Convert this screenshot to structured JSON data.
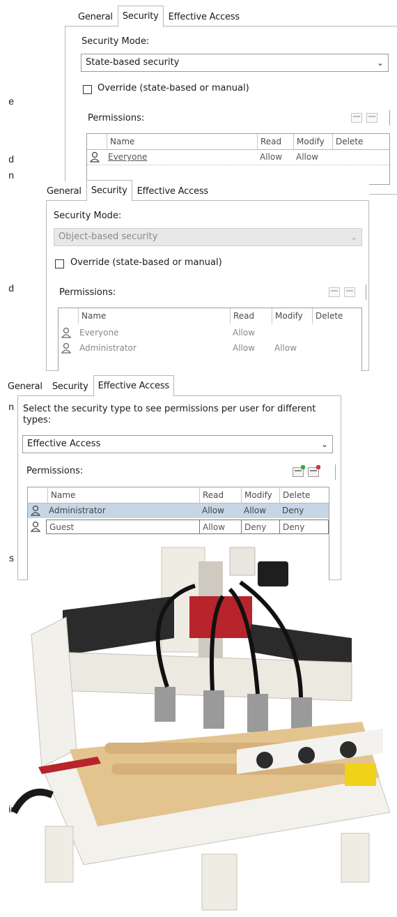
{
  "margin_fragments": [
    "e",
    "d",
    "n",
    "d",
    "n",
    "s",
    "ir"
  ],
  "panel1": {
    "tabs": [
      "General",
      "Security",
      "Effective Access"
    ],
    "active_tab": "Security",
    "security_mode_label": "Security Mode:",
    "security_mode_value": "State-based security",
    "override_label": "Override (state-based or manual)",
    "override_checked": false,
    "permissions_label": "Permissions:",
    "columns": [
      "Name",
      "Read",
      "Modify",
      "Delete"
    ],
    "rows": [
      {
        "name": "Everyone",
        "read": "Allow",
        "modify": "Allow",
        "delete": ""
      }
    ]
  },
  "panel2": {
    "tabs": [
      "General",
      "Security",
      "Effective Access"
    ],
    "active_tab": "Security",
    "security_mode_label": "Security Mode:",
    "security_mode_value": "Object-based security",
    "security_mode_disabled": true,
    "override_label": "Override (state-based or manual)",
    "override_checked": false,
    "permissions_label": "Permissions:",
    "columns": [
      "Name",
      "Read",
      "Modify",
      "Delete"
    ],
    "rows": [
      {
        "name": "Everyone",
        "read": "Allow",
        "modify": "",
        "delete": ""
      },
      {
        "name": "Administrator",
        "read": "Allow",
        "modify": "Allow",
        "delete": ""
      }
    ]
  },
  "panel3": {
    "tabs": [
      "General",
      "Security",
      "Effective Access"
    ],
    "active_tab": "Effective Access",
    "instruction": "Select the security type to see permissions per user for different types:",
    "type_value": "Effective Access",
    "permissions_label": "Permissions:",
    "columns": [
      "Name",
      "Read",
      "Modify",
      "Delete"
    ],
    "rows": [
      {
        "name": "Administrator",
        "read": "Allow",
        "modify": "Allow",
        "delete": "Deny",
        "selected": true
      },
      {
        "name": "Guest",
        "read": "Allow",
        "modify": "Deny",
        "delete": "Deny",
        "selected": false
      }
    ]
  },
  "colors": {
    "border": "#b8b8b8",
    "selected_row": "#c6d6e6",
    "icon_green": "#3aa64a",
    "icon_red": "#d23a3a",
    "machine_frame": "#f1efe8",
    "machine_wood": "#e3c48f",
    "machine_dark": "#2a2a2a"
  }
}
